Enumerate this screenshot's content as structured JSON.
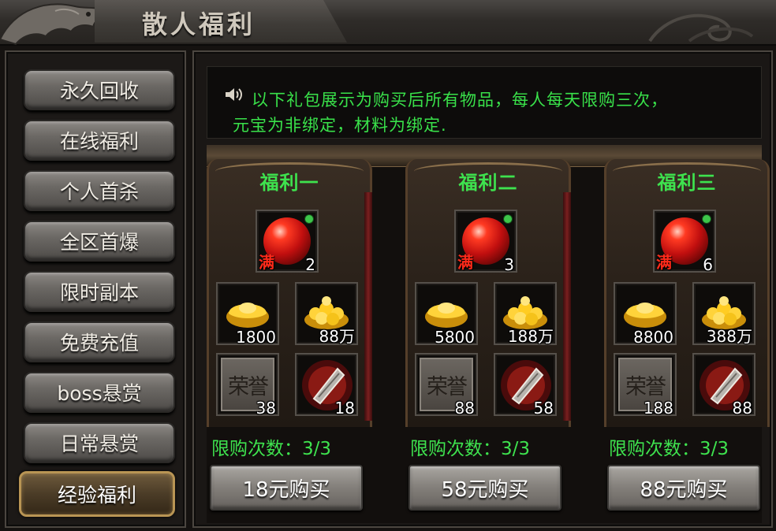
{
  "window": {
    "title": "散人福利"
  },
  "sidebar": {
    "items": [
      {
        "label": "永久回收",
        "active": false
      },
      {
        "label": "在线福利",
        "active": false
      },
      {
        "label": "个人首杀",
        "active": false
      },
      {
        "label": "全区首爆",
        "active": false
      },
      {
        "label": "限时副本",
        "active": false
      },
      {
        "label": "免费充值",
        "active": false
      },
      {
        "label": "boss悬赏",
        "active": false
      },
      {
        "label": "日常悬赏",
        "active": false
      },
      {
        "label": "经验福利",
        "active": true
      }
    ]
  },
  "notice": {
    "icon": "speaker-icon",
    "line1": "以下礼包展示为购买后所有物品，每人每天限购三次，",
    "line2": "元宝为非绑定，材料为绑定."
  },
  "packs": [
    {
      "name": "福利一",
      "orb": {
        "full_label": "满",
        "qty": "2"
      },
      "gold_ingot": {
        "qty": "1800"
      },
      "gold_coins": {
        "qty": "88万"
      },
      "honor": {
        "label": "荣誉",
        "qty": "38"
      },
      "stone": {
        "qty": "18"
      },
      "limit": "限购次数：3/3",
      "buy_label": "18元购买"
    },
    {
      "name": "福利二",
      "orb": {
        "full_label": "满",
        "qty": "3"
      },
      "gold_ingot": {
        "qty": "5800"
      },
      "gold_coins": {
        "qty": "188万"
      },
      "honor": {
        "label": "荣誉",
        "qty": "88"
      },
      "stone": {
        "qty": "58"
      },
      "limit": "限购次数：3/3",
      "buy_label": "58元购买"
    },
    {
      "name": "福利三",
      "orb": {
        "full_label": "满",
        "qty": "6"
      },
      "gold_ingot": {
        "qty": "8800"
      },
      "gold_coins": {
        "qty": "388万"
      },
      "honor": {
        "label": "荣誉",
        "qty": "188"
      },
      "stone": {
        "qty": "88"
      },
      "limit": "限购次数：3/3",
      "buy_label": "88元购买"
    }
  ],
  "colors": {
    "accent_green": "#3ee24e",
    "notice_green": "#39e14a",
    "full_red": "#ff2a1a",
    "active_border": "#b99554"
  }
}
